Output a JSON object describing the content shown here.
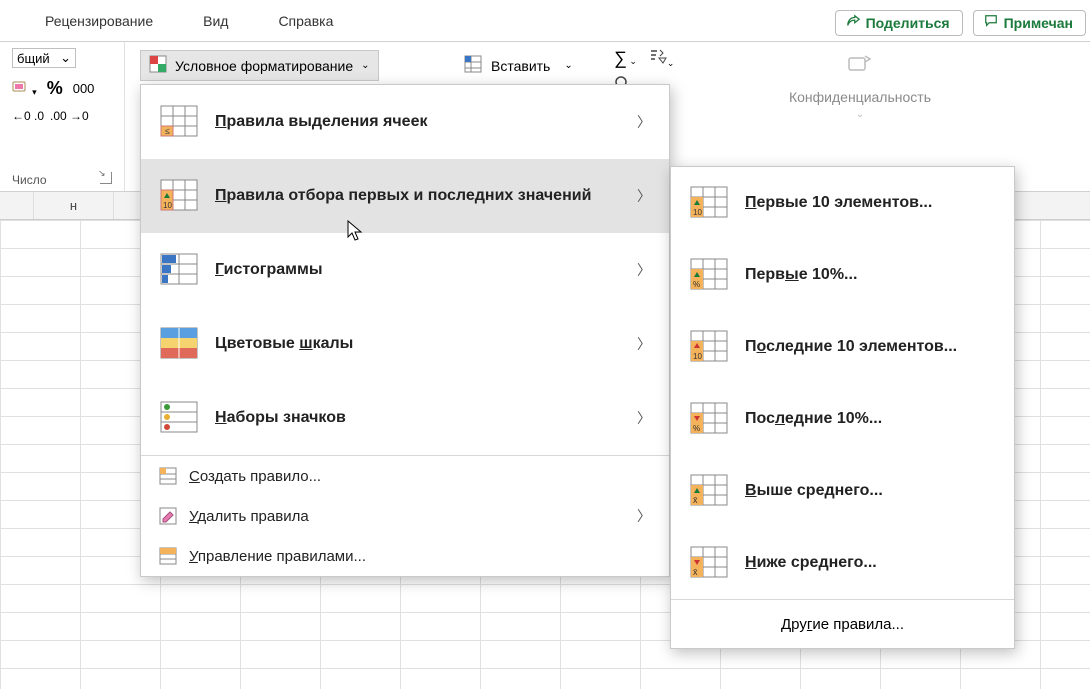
{
  "tabs": {
    "review": "Рецензирование",
    "view": "Вид",
    "help": "Справка"
  },
  "share": {
    "share_label": "Поделиться",
    "comments_label": "Примечан"
  },
  "number_group": {
    "label": "Число",
    "format_sel": "бщий",
    "dec1": ".0",
    "dec2": ".00"
  },
  "cond_fmt_button": "Условное форматирование",
  "insert_button": "Вставить",
  "sigma": "∑",
  "confidentiality": "Конфиденциальность",
  "col_header": "н",
  "menu1": {
    "highlight_rules": "Правила выделения ячеек",
    "top_bottom_rules": "Правила отбора первых и последних значений",
    "data_bars": "Гистограммы",
    "color_scales": "Цветовые шкалы",
    "icon_sets": "Наборы значков",
    "new_rule": "Создать правило...",
    "clear_rules": "Удалить правила",
    "manage_rules": "Управление правилами..."
  },
  "menu2": {
    "top10_items": "Первые 10 элементов...",
    "top10_pct": "Первые 10%...",
    "bottom10_items": "Последние 10 элементов...",
    "bottom10_pct": "Последние 10%...",
    "above_avg": "Выше среднего...",
    "below_avg": "Ниже среднего...",
    "more_rules": "Другие правила..."
  }
}
